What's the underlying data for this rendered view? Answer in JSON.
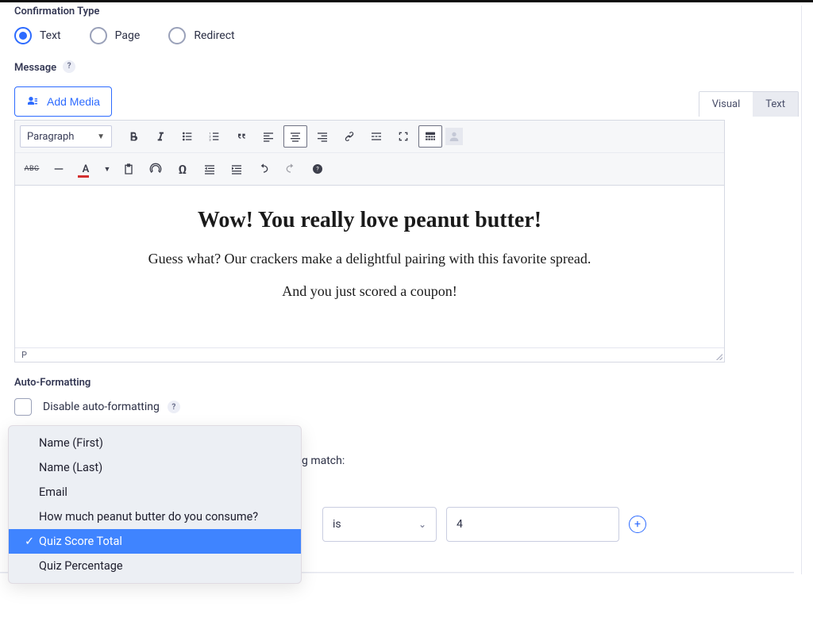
{
  "confirmation": {
    "section_label": "Confirmation Type",
    "options": {
      "text": "Text",
      "page": "Page",
      "redirect": "Redirect"
    },
    "selected": "text"
  },
  "message": {
    "label": "Message",
    "add_media": "Add Media",
    "tabs": {
      "visual": "Visual",
      "text": "Text"
    },
    "format_selector": "Paragraph",
    "path": "P",
    "content": {
      "heading": "Wow! You really love peanut butter!",
      "line1": "Guess what? Our crackers make a delightful pairing with this favorite spread.",
      "line2": "And you just scored a coupon!"
    }
  },
  "autofmt": {
    "label": "Auto-Formatting",
    "checkbox_label": "Disable auto-formatting"
  },
  "conditional": {
    "visible_text_fragment": "g match:",
    "operator": "is",
    "value": "4",
    "dropdown": {
      "items": [
        "Name (First)",
        "Name (Last)",
        "Email",
        "How much peanut butter do you consume?",
        "Quiz Score Total",
        "Quiz Percentage"
      ],
      "selected_index": 4
    }
  },
  "toolbar": {
    "row1": [
      "bold",
      "italic",
      "ul",
      "ol",
      "quote",
      "alignleft",
      "aligncenter",
      "alignright",
      "link",
      "more",
      "fullscreen",
      "toggle"
    ],
    "row2_abc": "ABC",
    "row2_a": "A"
  },
  "smart_tag_glyph": "{··}"
}
